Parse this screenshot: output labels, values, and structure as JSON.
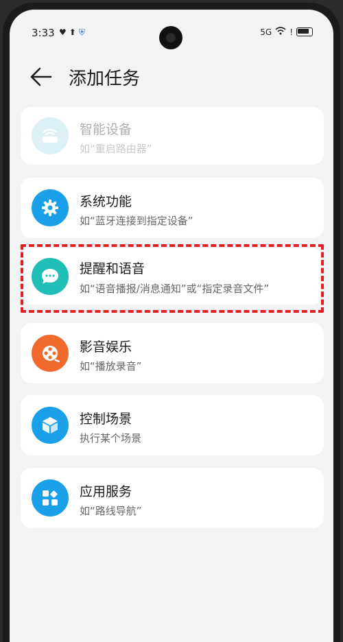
{
  "status_bar": {
    "time": "3:33",
    "left_icons": [
      "heart-icon",
      "upload-icon",
      "shield-icon"
    ],
    "network": "5G",
    "battery": "full"
  },
  "header": {
    "title": "添加任务"
  },
  "items": [
    {
      "title": "智能设备",
      "subtitle": "如“重启路由器”",
      "icon": "router-icon",
      "color": "#9fd6e6",
      "enabled": false
    },
    {
      "title": "系统功能",
      "subtitle": "如“蓝牙连接到指定设备”",
      "icon": "gear-icon",
      "color": "#1aa0e8",
      "enabled": true
    },
    {
      "title": "提醒和语音",
      "subtitle": "如“语音播报/消息通知”或“指定录音文件”",
      "icon": "chat-bubble-icon",
      "color": "#1fbfb8",
      "enabled": true,
      "highlighted": true
    },
    {
      "title": "影音娱乐",
      "subtitle": "如“播放录音”",
      "icon": "film-reel-icon",
      "color": "#f06a2e",
      "enabled": true
    },
    {
      "title": "控制场景",
      "subtitle": "执行某个场景",
      "icon": "cube-icon",
      "color": "#1aa0e8",
      "enabled": true
    },
    {
      "title": "应用服务",
      "subtitle": "如“路线导航”",
      "icon": "apps-grid-icon",
      "color": "#1aa0e8",
      "enabled": true
    }
  ]
}
